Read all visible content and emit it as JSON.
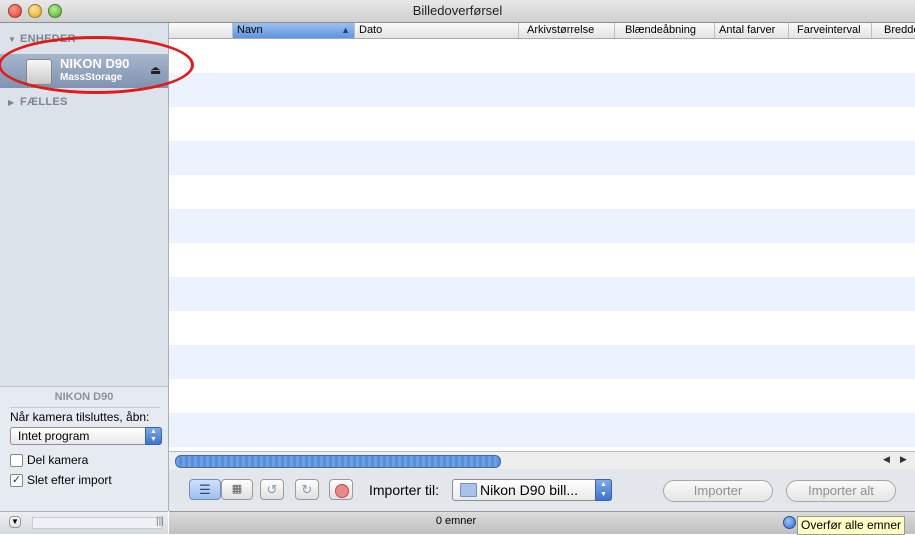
{
  "window": {
    "title": "Billedoverførsel"
  },
  "sidebar": {
    "devices_header": "ENHEDER",
    "shared_header": "FÆLLES",
    "device": {
      "name": "NIKON D90",
      "type": "MassStorage"
    }
  },
  "camera_panel": {
    "title": "NIKON D90",
    "open_label": "Når kamera tilsluttes, åbn:",
    "open_value": "Intet program",
    "delete_camera_label": "Del kamera",
    "delete_camera_checked": false,
    "delete_after_import_label": "Slet efter import",
    "delete_after_import_checked": true
  },
  "table": {
    "columns": [
      "",
      "Navn",
      "Dato",
      "Arkivstørrelse",
      "Blændeåbning",
      "Antal farver",
      "Farveinterval",
      "Bredde"
    ],
    "sorted_column": "Navn",
    "row_colors": [
      "#ffffff",
      "#edf3fe"
    ]
  },
  "toolbar": {
    "import_to_label": "Importer til:",
    "import_to_value": "Nikon D90 bill...",
    "import_button": "Importer",
    "import_all_button": "Importer alt"
  },
  "status": {
    "count": "0 emner",
    "tooltip": "Overfør alle emner"
  },
  "colors": {
    "selection": "#7f93b0",
    "annotation": "#e11a1a",
    "row_alt": "#edf3fe"
  }
}
